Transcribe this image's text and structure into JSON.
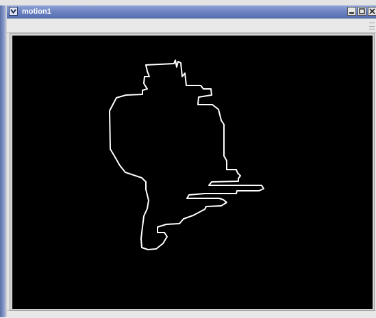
{
  "window": {
    "title": "motion1",
    "accent": "#6a80c0"
  },
  "controls": {
    "menu_icon": "chevron-down-icon",
    "minimize_icon": "minimize-icon",
    "maximize_icon": "maximize-icon",
    "close_icon": "close-icon"
  },
  "canvas": {
    "background": "#000000",
    "contour_color": "#ffffff"
  }
}
